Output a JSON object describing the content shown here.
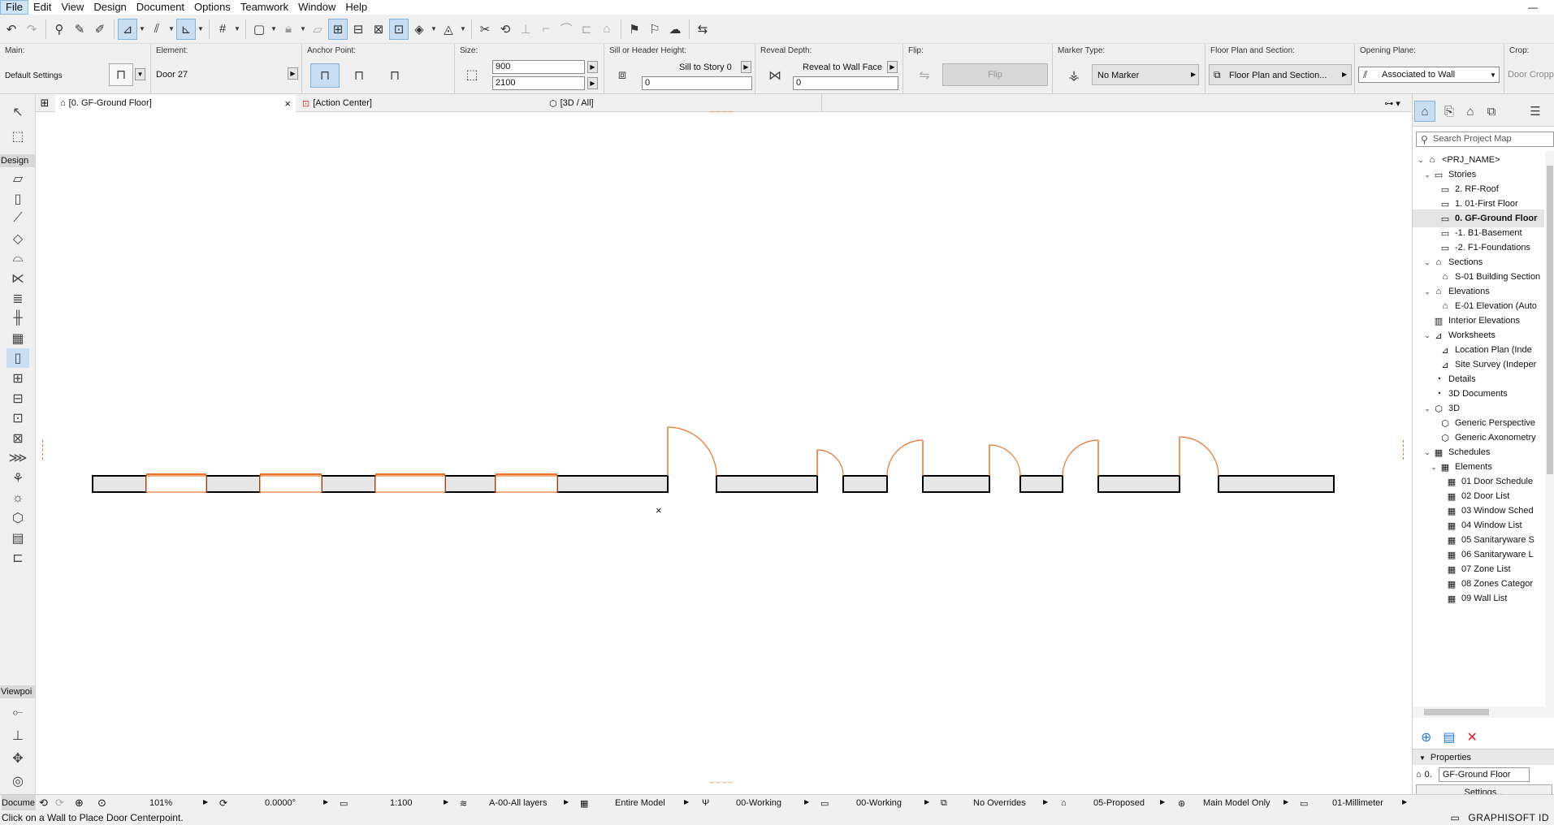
{
  "menu": [
    "File",
    "Edit",
    "View",
    "Design",
    "Document",
    "Options",
    "Teamwork",
    "Window",
    "Help"
  ],
  "minimize_glyph": "—",
  "infobox": {
    "main": {
      "label": "Main:",
      "value": "Default Settings"
    },
    "element": {
      "label": "Element:",
      "value": "Door 27"
    },
    "anchor": {
      "label": "Anchor Point:"
    },
    "size": {
      "label": "Size:",
      "width": "900",
      "height": "2100"
    },
    "sill": {
      "label": "Sill or Header Height:",
      "mode": "Sill to Story 0",
      "value": "0"
    },
    "reveal": {
      "label": "Reveal Depth:",
      "mode": "Reveal to Wall Face",
      "value": "0"
    },
    "flip": {
      "label": "Flip:",
      "button": "Flip"
    },
    "marker": {
      "label": "Marker Type:",
      "value": "No Marker"
    },
    "floorplan": {
      "label": "Floor Plan and Section:",
      "value": "Floor Plan and Section..."
    },
    "opening": {
      "label": "Opening Plane:",
      "value": "Associated to Wall"
    },
    "crop": {
      "label": "Crop:",
      "value": "Door Cropp"
    }
  },
  "tabs": {
    "floor": "[0. GF-Ground Floor]",
    "close": "×",
    "action": "[Action Center]",
    "view3d": "[3D / All]"
  },
  "toolbox": {
    "design_header": "Design",
    "viewpoint_header": "Viewpoi",
    "document_header": "Docume"
  },
  "navigator": {
    "search_placeholder": "Search Project Map",
    "tree": [
      {
        "label": "<PRJ_NAME>",
        "level": 0,
        "chev": "v",
        "icon": "home"
      },
      {
        "label": "Stories",
        "level": 1,
        "chev": "v",
        "icon": "folder"
      },
      {
        "label": "2. RF-Roof",
        "level": 2,
        "chev": "",
        "icon": "story"
      },
      {
        "label": "1. 01-First Floor",
        "level": 2,
        "chev": "",
        "icon": "story"
      },
      {
        "label": "0. GF-Ground Floor",
        "level": 2,
        "chev": "",
        "icon": "story",
        "selected": true
      },
      {
        "label": "-1. B1-Basement",
        "level": 2,
        "chev": "",
        "icon": "story"
      },
      {
        "label": "-2. F1-Foundations",
        "level": 2,
        "chev": "",
        "icon": "story"
      },
      {
        "label": "Sections",
        "level": 1,
        "chev": "v",
        "icon": "section"
      },
      {
        "label": "S-01 Building Section",
        "level": 2,
        "chev": "",
        "icon": "section"
      },
      {
        "label": "Elevations",
        "level": 1,
        "chev": "v",
        "icon": "elev"
      },
      {
        "label": "E-01 Elevation (Auto",
        "level": 2,
        "chev": "",
        "icon": "elev"
      },
      {
        "label": "Interior Elevations",
        "level": 1,
        "chev": "",
        "icon": "ie"
      },
      {
        "label": "Worksheets",
        "level": 1,
        "chev": "v",
        "icon": "ws"
      },
      {
        "label": "Location Plan (Inde",
        "level": 2,
        "chev": "",
        "icon": "ws"
      },
      {
        "label": "Site Survey (Indeper",
        "level": 2,
        "chev": "",
        "icon": "ws"
      },
      {
        "label": "Details",
        "level": 1,
        "chev": "",
        "icon": "detail"
      },
      {
        "label": "3D Documents",
        "level": 1,
        "chev": "",
        "icon": "detail"
      },
      {
        "label": "3D",
        "level": 1,
        "chev": "v",
        "icon": "cube"
      },
      {
        "label": "Generic Perspective",
        "level": 2,
        "chev": "",
        "icon": "cube"
      },
      {
        "label": "Generic Axonometry",
        "level": 2,
        "chev": "",
        "icon": "cube"
      },
      {
        "label": "Schedules",
        "level": 1,
        "chev": "v",
        "icon": "grid"
      },
      {
        "label": "Elements",
        "level": 2,
        "chev": "v",
        "icon": "grid"
      },
      {
        "label": "01 Door Schedule",
        "level": 3,
        "chev": "",
        "icon": "grid"
      },
      {
        "label": "02 Door List",
        "level": 3,
        "chev": "",
        "icon": "grid"
      },
      {
        "label": "03 Window Sched",
        "level": 3,
        "chev": "",
        "icon": "grid"
      },
      {
        "label": "04 Window List",
        "level": 3,
        "chev": "",
        "icon": "grid"
      },
      {
        "label": "05 Sanitaryware S",
        "level": 3,
        "chev": "",
        "icon": "grid"
      },
      {
        "label": "06 Sanitaryware L",
        "level": 3,
        "chev": "",
        "icon": "grid"
      },
      {
        "label": "07 Zone List",
        "level": 3,
        "chev": "",
        "icon": "grid"
      },
      {
        "label": "08 Zones Categor",
        "level": 3,
        "chev": "",
        "icon": "grid"
      },
      {
        "label": "09 Wall List",
        "level": 3,
        "chev": "",
        "icon": "grid"
      }
    ],
    "properties_header": "Properties",
    "prop_id": "0.",
    "prop_name": "GF-Ground Floor",
    "settings": "Settings..."
  },
  "statusbar": {
    "zoom": "101%",
    "angle": "0.0000°",
    "scale": "1:100",
    "layers": "A-00-All layers",
    "model": "Entire Model",
    "pen": "00-Working",
    "mvo": "00-Working",
    "override": "No Overrides",
    "reno": "05-Proposed",
    "struct": "Main Model Only",
    "dim": "01-Millimeter"
  },
  "hint": "Click on a Wall to Place Door Centerpoint.",
  "brand": "GRAPHISOFT ID",
  "canvas": {
    "cursor_mark": "×",
    "marker_top": "– – – –",
    "marker_bottom": "– – – –"
  },
  "colors": {
    "wall_fill": "#e6e6e6",
    "opening": "#e8742a",
    "selection": "#c9def2"
  }
}
